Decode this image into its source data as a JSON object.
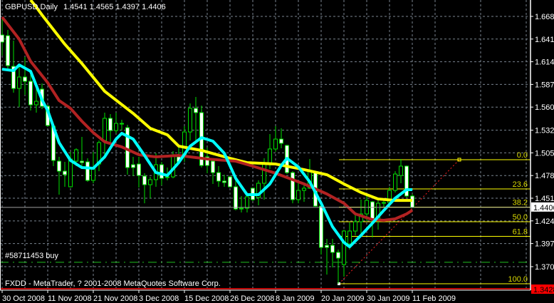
{
  "header": {
    "symbol": "GBPUSD,Daily",
    "ohlc": "1.4541 1.4565 1.4397 1.4406"
  },
  "order_label": "#58711453 buy",
  "copyright": "FXDD - MetaTrader, ? 2001-2008 MetaQuotes Software Corp.",
  "colors": {
    "background": "#000000",
    "grid": "#7a8590",
    "bull_body": "#000000",
    "bear_body": "#ffffff",
    "candle_outline": "#00e000",
    "ma_fast": "#00ffff",
    "ma_slow": "#ffff00",
    "ma_mid": "#b22222",
    "fib": "#ffff00",
    "fib_label": "#d8d800",
    "trend": "#ff2020",
    "order": "#20c020",
    "bid": "#ffffff",
    "low_mark": "#ff0000",
    "axis_text": "#ffffff"
  },
  "chart_data": {
    "type": "candlestick",
    "title": "GBPUSD,Daily",
    "ylim": [
      1.342,
      1.6875
    ],
    "y_ticks": [
      "1.6680",
      "1.6410",
      "1.6140",
      "1.5870",
      "1.5600",
      "1.5325",
      "1.5055",
      "1.4785",
      "1.4515",
      "1.4245",
      "1.3975",
      "1.3700"
    ],
    "x_ticks": [
      {
        "bar": 0,
        "label": "30 Oct 2008"
      },
      {
        "bar": 8,
        "label": "11 Nov 2008"
      },
      {
        "bar": 16,
        "label": "21 Nov 2008"
      },
      {
        "bar": 24,
        "label": "3 Dec 2008"
      },
      {
        "bar": 32,
        "label": "15 Dec 2008"
      },
      {
        "bar": 40,
        "label": "26 Dec 2008"
      },
      {
        "bar": 48,
        "label": "8 Jan 2009"
      },
      {
        "bar": 56,
        "label": "20 Jan 2009"
      },
      {
        "bar": 64,
        "label": "30 Jan 2009"
      },
      {
        "bar": 72,
        "label": "11 Feb 2009"
      }
    ],
    "ohlc": [
      [
        1.6459,
        1.6646,
        1.6213,
        1.6374
      ],
      [
        1.645,
        1.6518,
        1.6026,
        1.6094
      ],
      [
        1.6085,
        1.6391,
        1.5771,
        1.5822
      ],
      [
        1.5822,
        1.6094,
        1.5601,
        1.5958
      ],
      [
        1.5958,
        1.6196,
        1.5746,
        1.5907
      ],
      [
        1.5907,
        1.6009,
        1.5559,
        1.5627
      ],
      [
        1.5627,
        1.5856,
        1.5534,
        1.5669
      ],
      [
        1.5814,
        1.5882,
        1.5576,
        1.561
      ],
      [
        1.561,
        1.5627,
        1.5364,
        1.5381
      ],
      [
        1.5372,
        1.5389,
        1.4897,
        1.4965
      ],
      [
        1.4956,
        1.5007,
        1.4557,
        1.4837
      ],
      [
        1.4837,
        1.4948,
        1.4651,
        1.4795
      ],
      [
        1.4651,
        1.5067,
        1.4642,
        1.4982
      ],
      [
        1.4956,
        1.5109,
        1.4897,
        1.5092
      ],
      [
        1.4956,
        1.5245,
        1.4897,
        1.4939
      ],
      [
        1.4948,
        1.499,
        1.471,
        1.4727
      ],
      [
        1.4727,
        1.5067,
        1.4693,
        1.4863
      ],
      [
        1.4922,
        1.5202,
        1.4837,
        1.5177
      ],
      [
        1.5202,
        1.5534,
        1.5007,
        1.5466
      ],
      [
        1.5466,
        1.5517,
        1.5177,
        1.5321
      ],
      [
        1.5321,
        1.5534,
        1.5287,
        1.5406
      ],
      [
        1.5406,
        1.5449,
        1.5321,
        1.5398
      ],
      [
        1.5355,
        1.5389,
        1.4795,
        1.488
      ],
      [
        1.4914,
        1.5007,
        1.4778,
        1.488
      ],
      [
        1.4922,
        1.5007,
        1.4642,
        1.4786
      ],
      [
        1.4778,
        1.4812,
        1.4455,
        1.4676
      ],
      [
        1.4676,
        1.4769,
        1.4515,
        1.4736
      ],
      [
        1.4736,
        1.505,
        1.4651,
        1.4914
      ],
      [
        1.4914,
        1.4948,
        1.4668,
        1.4752
      ],
      [
        1.4769,
        1.488,
        1.4727,
        1.4761
      ],
      [
        1.4769,
        1.5075,
        1.4752,
        1.5033
      ],
      [
        1.5007,
        1.5135,
        1.4922,
        1.4948
      ],
      [
        1.5007,
        1.5372,
        1.4948,
        1.5304
      ],
      [
        1.5304,
        1.5644,
        1.5202,
        1.5585
      ],
      [
        1.5585,
        1.572,
        1.5202,
        1.5534
      ],
      [
        1.5534,
        1.5618,
        1.488,
        1.4905
      ],
      [
        1.5007,
        1.5118,
        1.4812,
        1.4905
      ],
      [
        1.4956,
        1.4982,
        1.4685,
        1.482
      ],
      [
        1.482,
        1.4897,
        1.4651,
        1.4719
      ],
      [
        1.4719,
        1.4795,
        1.4651,
        1.4702
      ],
      [
        1.4769,
        1.4778,
        1.4642,
        1.4651
      ],
      [
        1.4651,
        1.4769,
        1.437,
        1.4387
      ],
      [
        1.4387,
        1.454,
        1.4345,
        1.4396
      ],
      [
        1.4396,
        1.4583,
        1.4345,
        1.4532
      ],
      [
        1.4634,
        1.4642,
        1.4481,
        1.4498
      ],
      [
        1.4523,
        1.4727,
        1.443,
        1.4693
      ],
      [
        1.4693,
        1.499,
        1.4498,
        1.4922
      ],
      [
        1.4922,
        1.5279,
        1.4863,
        1.5101
      ],
      [
        1.5101,
        1.5372,
        1.5067,
        1.5219
      ],
      [
        1.5219,
        1.5347,
        1.5109,
        1.5169
      ],
      [
        1.5143,
        1.5152,
        1.4803,
        1.482
      ],
      [
        1.482,
        1.4837,
        1.4455,
        1.4498
      ],
      [
        1.4498,
        1.4727,
        1.4455,
        1.4608
      ],
      [
        1.4608,
        1.4685,
        1.4472,
        1.4634
      ],
      [
        1.4634,
        1.4982,
        1.4625,
        1.4837
      ],
      [
        1.482,
        1.4837,
        1.4413,
        1.4421
      ],
      [
        1.4421,
        1.4438,
        1.3844,
        1.3929
      ],
      [
        1.3954,
        1.4031,
        1.3606,
        1.3929
      ],
      [
        1.3954,
        1.4031,
        1.3691,
        1.387
      ],
      [
        1.387,
        1.3903,
        1.3496,
        1.3802
      ],
      [
        1.3725,
        1.4141,
        1.3581,
        1.4124
      ],
      [
        1.3971,
        1.4226,
        1.3903,
        1.4124
      ],
      [
        1.4124,
        1.4311,
        1.4073,
        1.4235
      ],
      [
        1.4235,
        1.4498,
        1.4073,
        1.4328
      ],
      [
        1.4328,
        1.4557,
        1.4243,
        1.4489
      ],
      [
        1.4472,
        1.4481,
        1.4048,
        1.4269
      ],
      [
        1.4243,
        1.4523,
        1.4141,
        1.4455
      ],
      [
        1.4455,
        1.4498,
        1.4413,
        1.4464
      ],
      [
        1.4464,
        1.4651,
        1.4438,
        1.4608
      ],
      [
        1.4608,
        1.4837,
        1.4583,
        1.4803
      ],
      [
        1.4786,
        1.4982,
        1.4693,
        1.4897
      ],
      [
        1.4897,
        1.4905,
        1.4523,
        1.4541
      ],
      [
        1.4541,
        1.4565,
        1.4397,
        1.4406
      ]
    ],
    "ma_fast": [
      [
        0,
        1.6051
      ],
      [
        2,
        1.6034
      ],
      [
        3,
        1.6102
      ],
      [
        5,
        1.6026
      ],
      [
        7,
        1.5686
      ],
      [
        8,
        1.5559
      ],
      [
        10,
        1.5177
      ],
      [
        12,
        1.4965
      ],
      [
        14,
        1.488
      ],
      [
        16,
        1.4871
      ],
      [
        18,
        1.5007
      ],
      [
        20,
        1.5219
      ],
      [
        21,
        1.5287
      ],
      [
        23,
        1.5219
      ],
      [
        25,
        1.5024
      ],
      [
        27,
        1.482
      ],
      [
        29,
        1.4786
      ],
      [
        31,
        1.4939
      ],
      [
        33,
        1.5135
      ],
      [
        35,
        1.5236
      ],
      [
        37,
        1.5194
      ],
      [
        39,
        1.505
      ],
      [
        41,
        1.4752
      ],
      [
        43,
        1.4557
      ],
      [
        45,
        1.4557
      ],
      [
        47,
        1.4685
      ],
      [
        49,
        1.4905
      ],
      [
        50,
        1.499
      ],
      [
        52,
        1.4888
      ],
      [
        54,
        1.471
      ],
      [
        56,
        1.4455
      ],
      [
        58,
        1.4175
      ],
      [
        60,
        1.3988
      ],
      [
        61,
        1.3937
      ],
      [
        63,
        1.4073
      ],
      [
        65,
        1.4218
      ],
      [
        67,
        1.437
      ],
      [
        69,
        1.4515
      ],
      [
        71,
        1.4617
      ],
      [
        72,
        1.4617
      ]
    ],
    "ma_slow": [
      [
        5,
        1.6875
      ],
      [
        6,
        1.679
      ],
      [
        7,
        1.6697
      ],
      [
        11,
        1.6349
      ],
      [
        14,
        1.6119
      ],
      [
        18,
        1.5788
      ],
      [
        23,
        1.5525
      ],
      [
        26,
        1.5347
      ],
      [
        29,
        1.527
      ],
      [
        31,
        1.5135
      ],
      [
        35,
        1.5084
      ],
      [
        40,
        1.499
      ],
      [
        43,
        1.4939
      ],
      [
        48,
        1.4922
      ],
      [
        53,
        1.4855
      ],
      [
        57,
        1.4795
      ],
      [
        60,
        1.4685
      ],
      [
        63,
        1.4583
      ],
      [
        66,
        1.4506
      ],
      [
        69,
        1.4489
      ],
      [
        72,
        1.4489
      ]
    ],
    "ma_mid": [
      [
        0,
        1.6671
      ],
      [
        3,
        1.6408
      ],
      [
        5,
        1.6145
      ],
      [
        8,
        1.589
      ],
      [
        10,
        1.5678
      ],
      [
        12,
        1.5585
      ],
      [
        14,
        1.5432
      ],
      [
        16,
        1.5296
      ],
      [
        18,
        1.5186
      ],
      [
        21,
        1.5126
      ],
      [
        24,
        1.5033
      ],
      [
        27,
        1.5007
      ],
      [
        31,
        1.5024
      ],
      [
        36,
        1.4982
      ],
      [
        41,
        1.4956
      ],
      [
        44,
        1.4897
      ],
      [
        48,
        1.4812
      ],
      [
        50,
        1.4761
      ],
      [
        53,
        1.4685
      ],
      [
        57,
        1.4566
      ],
      [
        60,
        1.4455
      ],
      [
        62,
        1.4328
      ],
      [
        65,
        1.426
      ],
      [
        67,
        1.4252
      ],
      [
        69,
        1.4269
      ],
      [
        71,
        1.4328
      ],
      [
        72,
        1.4371
      ]
    ],
    "fibonacci": {
      "start_bar": 59,
      "high": 1.4974,
      "low": 1.3496,
      "levels": [
        {
          "label": "0.0",
          "price": 1.4974
        },
        {
          "label": "23.6",
          "price": 1.4625
        },
        {
          "label": "38.2",
          "price": 1.4409
        },
        {
          "label": "50.0",
          "price": 1.4235
        },
        {
          "label": "61.8",
          "price": 1.4061
        },
        {
          "label": "100.0",
          "price": 1.3496
        }
      ]
    },
    "order_line": 1.3752,
    "bid": {
      "price": 1.4406,
      "label": "1.4406"
    },
    "low_marker": {
      "price": 1.3428,
      "label": "1.3428"
    }
  }
}
